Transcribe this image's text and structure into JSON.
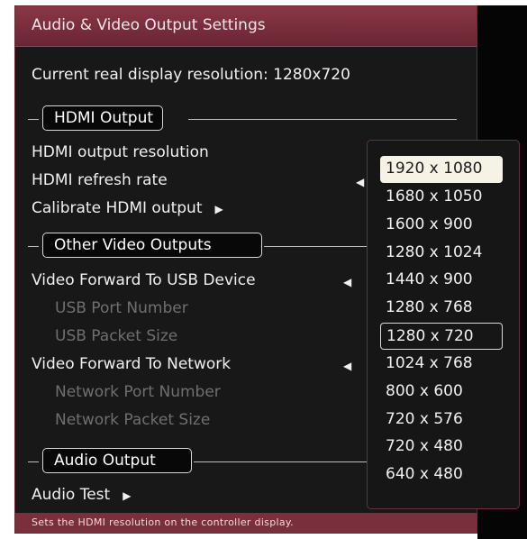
{
  "window": {
    "title": "Audio & Video Output Settings"
  },
  "current_resolution_text": "Current  real  display  resolution:  1280x720",
  "sections": {
    "hdmi": "HDMI Output",
    "video": "Other Video Outputs",
    "audio": "Audio Output"
  },
  "items": {
    "hdmi_resolution": "HDMI output resolution",
    "hdmi_refresh": "HDMI refresh rate",
    "calibrate": "Calibrate HDMI output",
    "video_usb": "Video Forward To USB Device",
    "usb_port": "USB Port Number",
    "usb_packet": "USB Packet Size",
    "video_network": "Video Forward To Network",
    "network_port": "Network Port Number",
    "network_packet": "Network Packet Size",
    "audio_test": "Audio Test"
  },
  "dropdown": {
    "options": [
      "1920 x 1080",
      "1680 x 1050",
      "1600 x 900",
      "1280 x 1024",
      "1440 x 900",
      "1280 x 768",
      "1280 x 720",
      "1024 x 768",
      "800 x 600",
      "720 x 576",
      "720 x 480",
      "640 x 480"
    ],
    "highlighted": "1920 x 1080",
    "current": "1280 x 720"
  },
  "footer": "Sets  the  HDMI resolution  on  the  controller  display.",
  "icons": {
    "submenu": "triangle-right-icon",
    "value_left": "triangle-left-icon"
  },
  "colors": {
    "accent": "#7a2f3c",
    "background": "#181818",
    "highlight": "#f7f2e6"
  }
}
